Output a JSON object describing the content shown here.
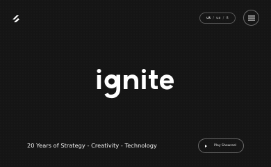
{
  "header": {
    "logo_icon": "ignite-logo-mark",
    "languages": [
      "uk",
      "ua",
      "it"
    ],
    "active_language": "uk",
    "menu_icon": "hamburger-icon"
  },
  "hero": {
    "brand": "ignite",
    "tagline": "20 Years of Strategy - Creativity - Technology",
    "showreel_label": "Play Showreel",
    "showreel_icon": "play-icon"
  },
  "colors": {
    "background": "#151515",
    "text": "#ffffff",
    "border": "#6a6a6a"
  }
}
